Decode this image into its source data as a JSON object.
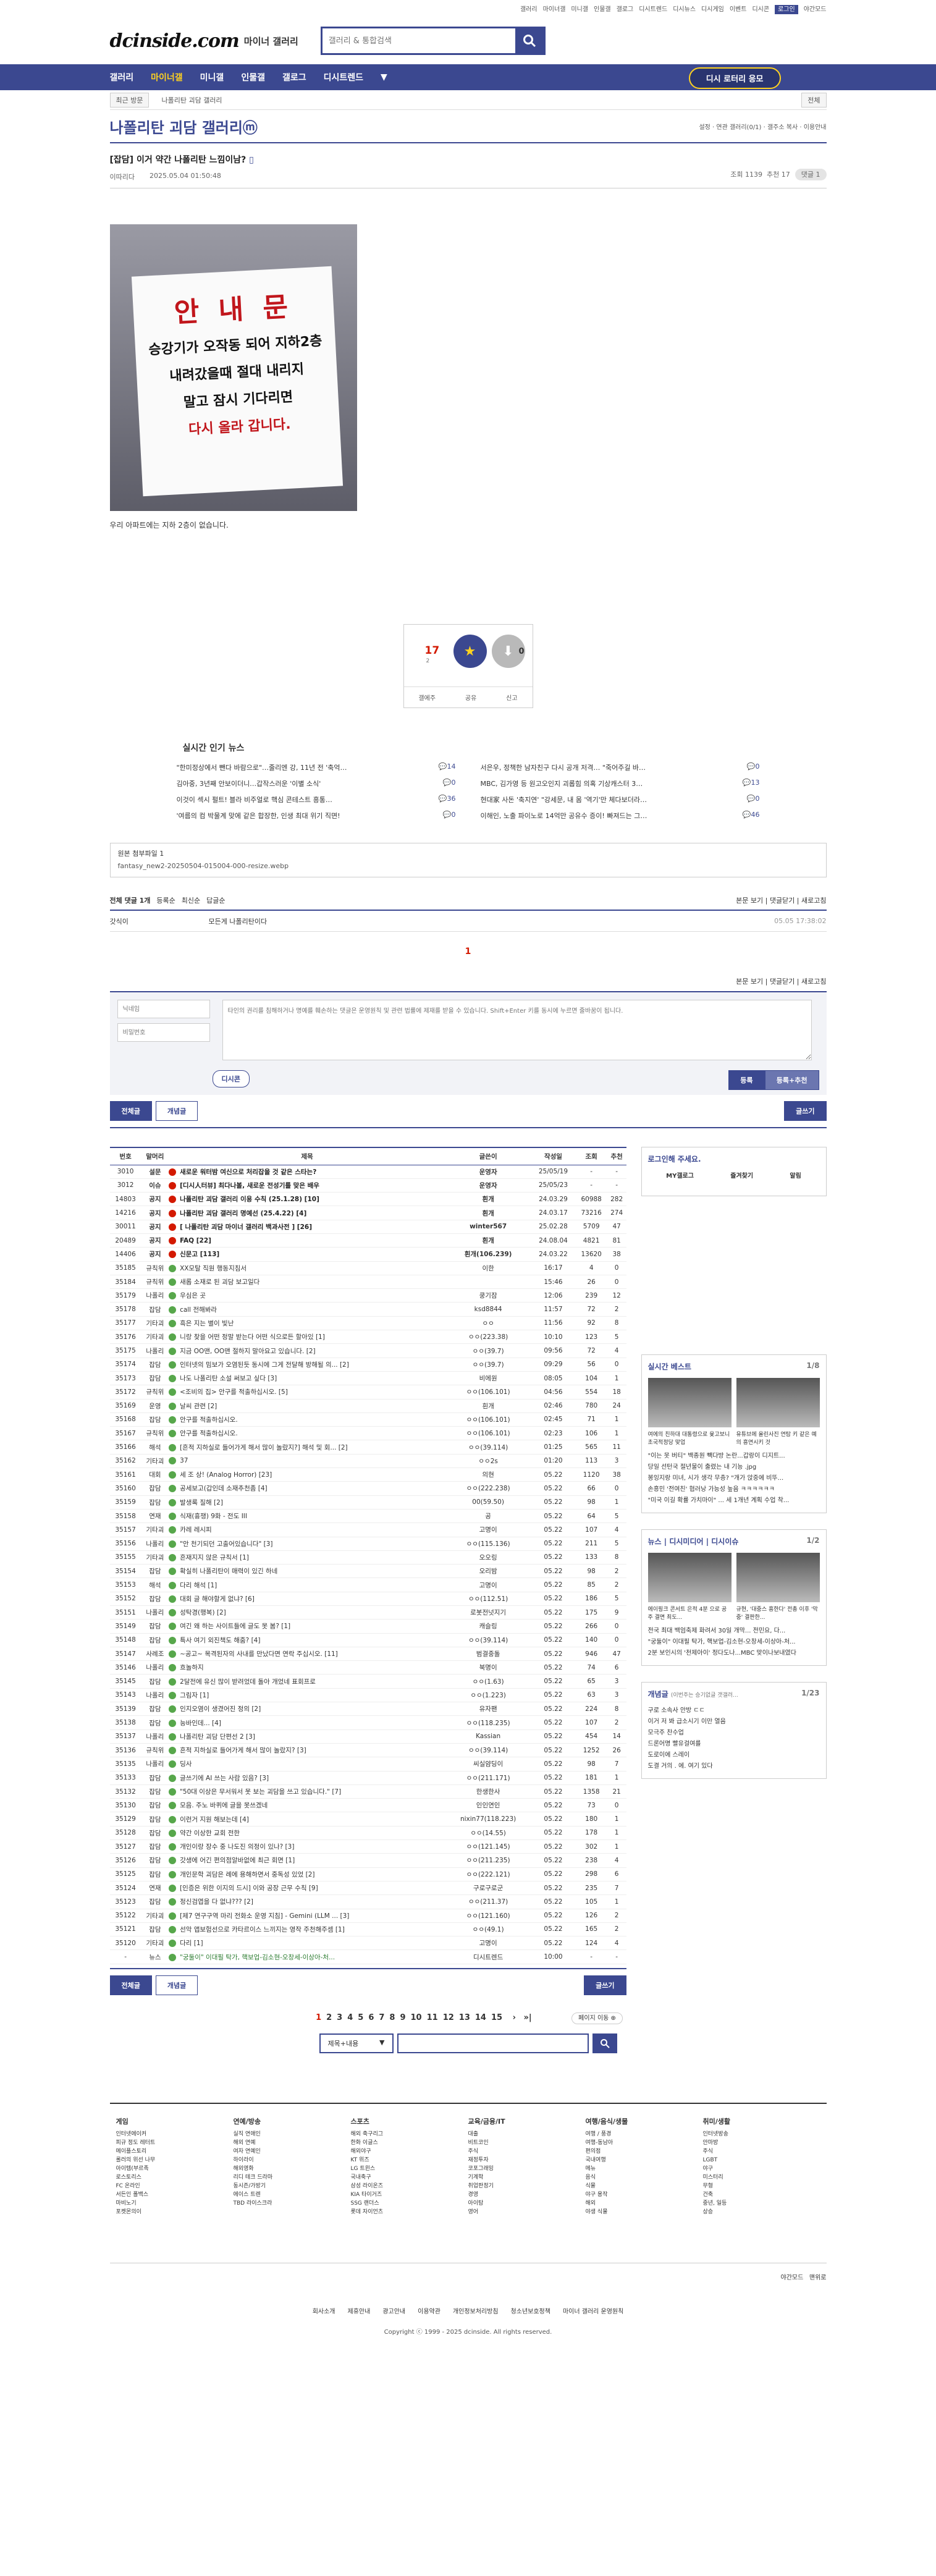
{
  "topbar": [
    "갤러리",
    "마이너갤",
    "미니갤",
    "인물갤",
    "갤로그",
    "디시트렌드",
    "디시뉴스",
    "디시게임",
    "이벤트",
    "디시콘",
    "로그인",
    "야간모드"
  ],
  "header": {
    "logo": "dcinside.com",
    "logo_sub": "마이너 갤러리",
    "search_placeholder": "갤러리 & 통합검색"
  },
  "nav": {
    "items": [
      "갤러리",
      "마이너갤",
      "미니갤",
      "인물갤",
      "갤로그",
      "디시트렌드"
    ],
    "menu_button": "디시 로터리 응모"
  },
  "subnav": {
    "recent": "최근 방문",
    "gallery": "나폴리탄 괴담 갤러리",
    "close": "전체"
  },
  "gallery": {
    "title": "나폴리탄 괴담 갤러리ⓜ",
    "options": "설정 · 연관 갤러리(0/1) · 갤주소 복사 · 이용안내"
  },
  "post": {
    "category": "[잡담]",
    "title": "이거 약간 나폴리탄 느낌이남?",
    "author": "이따리다",
    "date": "2025.05.04 01:50:48",
    "views": "조회 1139",
    "recommend": "추천 17",
    "comments": "댓글 1",
    "notice_big": "안 내 문",
    "notice_lines": [
      "승강기가 오작동 되어 지하2층",
      "내려갔을때 절대 내리지",
      "말고 잠시 기다리면",
      "다시 올라 갑니다."
    ],
    "body": "우리 아파트에는 지하 2층이 없습니다."
  },
  "recommend_box": {
    "up": "17",
    "up_sub": "2",
    "up_label": "개념",
    "down": "0",
    "share": "공유",
    "report": "신고",
    "gallery_share": "갤에주"
  },
  "news": {
    "title": "실시간 인기 뉴스",
    "items": [
      [
        "\"한미정상에서 뺀다 바람으로\"…줄리엔 강, 11년 전 '축억…",
        "14"
      ],
      [
        "서은우, 정책한 남자친구 다시 공개 저격… \"죽어주길 바…",
        "0"
      ],
      [
        "김아중, 3년째 안보이더니…갑작스러운 '이별 소식'",
        "0"
      ],
      [
        "MBC, 김가영 등 원고오인지 괴롭힘 의혹 기상캐스터 3…",
        "13"
      ],
      [
        "이것이 섹시 펄트! 블라 비주얼로 핵심 콘테스트 흥통…",
        "36"
      ],
      [
        "현대家 사돈 '축지연' \"강세문, 내 몸 '역기'만 체다보더라…",
        "0"
      ],
      [
        "'여름의 컴 박물계 맞에 같은 합장한, 인생 최대 위기 직면!",
        "0"
      ],
      [
        "이해인, 노출 파이노로 14억만 공유수 증이! 빠져드는 그…",
        "46"
      ]
    ]
  },
  "attach": {
    "label": "원본 첨부파일 1",
    "file": "fantasy_new2-20250504-015004-000-resize.webp"
  },
  "comment_head": {
    "all": "전체 댓글 1개",
    "opt1": "등록순",
    "opt2": "최신순",
    "opt3": "답글순",
    "right": "본문 보기 | 댓글닫기 | 새로고침"
  },
  "comment": {
    "author": "갓식이",
    "text": "모든게 나폴리탄이다",
    "date": "05.05 17:38:02"
  },
  "comment_page": "1",
  "write": {
    "name": "닉네임",
    "pw": "비밀번호",
    "content": "타인의 권리를 침해하거나 명예를 훼손하는 댓글은 운영원칙 및 관련 법률에 제재를 받을 수 있습니다. Shift+Enter 키를 동시에 누르면 줄바꿈이 됩니다.",
    "dccon": "디시콘",
    "submit": "등록",
    "submit2": "등록+추천"
  },
  "listbar": {
    "all": "전체글",
    "best": "개념글",
    "write": "글쓰기"
  },
  "table": {
    "headers": [
      "번호",
      "말머리",
      "제목",
      "글쓴이",
      "작성일",
      "조회",
      "추천"
    ],
    "rows": [
      [
        "3010",
        "설문",
        "새로운 워터밤 여신으로 처리잡을 것 같은 스타는?",
        "운영자",
        "25/05/19",
        "-",
        "-",
        "nt"
      ],
      [
        "3012",
        "이슈",
        "[디시人터뷰] 최다나볼, 새로운 전성기를 맞은 배우",
        "운영자",
        "25/05/23",
        "-",
        "-",
        "nt"
      ],
      [
        "14803",
        "공지",
        "나폴리탄 괴담 갤러리 이용 수칙 (25.1.28) [10]",
        "흰개",
        "24.03.29",
        "60988",
        "282",
        "nt"
      ],
      [
        "14216",
        "공지",
        "나폴리탄 괴담 갤러리 명예선 (25.4.22) [4]",
        "흰개",
        "24.03.17",
        "73216",
        "274",
        "nt"
      ],
      [
        "30011",
        "공지",
        "[ 나폴리탄 괴담 마이너 갤러리 백과사전 ] [26]",
        "winter567",
        "25.02.28",
        "5709",
        "47",
        "nt"
      ],
      [
        "20489",
        "공지",
        "FAQ [22]",
        "흰개",
        "24.08.04",
        "4821",
        "81",
        "nt"
      ],
      [
        "14406",
        "공지",
        "신문고 [113]",
        "흰개(106.239)",
        "24.03.22",
        "13620",
        "38",
        "nt"
      ],
      [
        "35185",
        "규칙위",
        "XX모탈 직원 행동지침서",
        "이한",
        "16:17",
        "4",
        "0",
        ""
      ],
      [
        "35184",
        "규칙위",
        "새롭 소재로 된 괴담 보고일다",
        "",
        "15:46",
        "26",
        "0",
        ""
      ],
      [
        "35179",
        "나폴리",
        "우심은 곳",
        "쿵기잠",
        "12:06",
        "239",
        "12",
        ""
      ],
      [
        "35178",
        "잡담",
        "call 전해봐라",
        "ksd8844",
        "11:57",
        "72",
        "2",
        ""
      ],
      [
        "35177",
        "기타괴",
        "흑은 지는 별이 빛난",
        "ㅇㅇ",
        "11:56",
        "92",
        "8",
        ""
      ],
      [
        "35176",
        "기타괴",
        "니랑 찾을 어떤 정말 받는다 어떤 식으로든 할아있 [1]",
        "ㅇㅇ(223.38)",
        "10:10",
        "123",
        "5",
        ""
      ],
      [
        "35175",
        "나폴리",
        "지금 OO맨, OO맨 절하지 말아요고 있습니다. [2]",
        "ㅇㅇ(39.7)",
        "09:56",
        "72",
        "4",
        ""
      ],
      [
        "35174",
        "잡담",
        "인터넷의 밈보가 오염된듯 동시에 그게 전달해 방해될 의... [2]",
        "ㅇㅇ(39.7)",
        "09:29",
        "56",
        "0",
        ""
      ],
      [
        "35173",
        "잡담",
        "나도 나폴리탄 소설 써보고 싶다 [3]",
        "비에원",
        "08:05",
        "104",
        "1",
        ""
      ],
      [
        "35172",
        "규칙위",
        "<조비의 집> 안구를 적출하십시오. [5]",
        "ㅇㅇ(106.101)",
        "04:56",
        "554",
        "18",
        ""
      ],
      [
        "35169",
        "운영",
        "날씨 관련 [2]",
        "흰개",
        "02:46",
        "780",
        "24",
        ""
      ],
      [
        "35168",
        "잡담",
        "안구를 적출하십시오.",
        "ㅇㅇ(106.101)",
        "02:45",
        "71",
        "1",
        ""
      ],
      [
        "35167",
        "규칙위",
        "안구를 적출하십시오.",
        "ㅇㅇ(106.101)",
        "02:23",
        "106",
        "1",
        ""
      ],
      [
        "35166",
        "해석",
        "[흔적 지하실로 들어가게 해서 많이 놀랐지?] 해석 및 회... [2]",
        "ㅇㅇ(39.114)",
        "01:25",
        "565",
        "11",
        ""
      ],
      [
        "35162",
        "기타괴",
        "37",
        "ㅇㅇ2s",
        "01:20",
        "113",
        "3",
        ""
      ],
      [
        "35161",
        "대회",
        "세 조 상! (Analog Horror) [23]",
        "의현",
        "05.22",
        "1120",
        "38",
        ""
      ],
      [
        "35160",
        "잡담",
        "공세보고(갑인데 소재추천좀 [4]",
        "ㅇㅇ(222.238)",
        "05.22",
        "66",
        "0",
        ""
      ],
      [
        "35159",
        "잡담",
        "발생록 질해 [2]",
        "00(59.50)",
        "05.22",
        "98",
        "1",
        ""
      ],
      [
        "35158",
        "연재",
        "식재(흉쟁) 9화 - 전도 III",
        "공",
        "05.22",
        "64",
        "5",
        ""
      ],
      [
        "35157",
        "기타괴",
        "카레 레시피",
        "고명이",
        "05.22",
        "107",
        "4",
        ""
      ],
      [
        "35156",
        "나폴리",
        "\"안 천기되던 고출어있습니다\" [3]",
        "ㅇㅇ(115.136)",
        "05.22",
        "211",
        "5",
        ""
      ],
      [
        "35155",
        "기타괴",
        "흔재지지 않은 규칙서 [1]",
        "오오링",
        "05.22",
        "133",
        "8",
        ""
      ],
      [
        "35154",
        "잡담",
        "확실히 나폴리탄이 매력이 있긴 하네",
        "오리밤",
        "05.22",
        "98",
        "2",
        ""
      ],
      [
        "35153",
        "해석",
        "다리 해석 [1]",
        "고명이",
        "05.22",
        "85",
        "2",
        ""
      ],
      [
        "35152",
        "잡담",
        "대회 글 해야할게 없냐? [6]",
        "ㅇㅇ(112.51)",
        "05.22",
        "186",
        "5",
        ""
      ],
      [
        "35151",
        "나폴리",
        "성탁경(행복) [2]",
        "로봇전넛지기",
        "05.22",
        "175",
        "9",
        ""
      ],
      [
        "35149",
        "잡담",
        "여긴 왜 하는 사이트들에 글도 못 봄? [1]",
        "캐슬링",
        "05.22",
        "266",
        "0",
        ""
      ],
      [
        "35148",
        "잡담",
        "특사 여기 외진책도 해줌? [4]",
        "ㅇㅇ(39.114)",
        "05.22",
        "140",
        "0",
        ""
      ],
      [
        "35147",
        "사례조",
        "~공고~ 목격된자의 사내를 만났다면 연락 주십시오. [11]",
        "범결중돌",
        "05.22",
        "946",
        "47",
        ""
      ],
      [
        "35146",
        "나폴리",
        "흐놀하지",
        "북명이",
        "05.22",
        "74",
        "6",
        ""
      ],
      [
        "35145",
        "잡담",
        "2달전에 유신 많이 받려었데 돌아 개었네 표회프로",
        "ㅇㅇ(1.63)",
        "05.22",
        "65",
        "3",
        ""
      ],
      [
        "35143",
        "나폴리",
        "그림자 [1]",
        "ㅇㅇ(1.223)",
        "05.22",
        "63",
        "3",
        ""
      ],
      [
        "35139",
        "잡담",
        "인지오염이 생겼어진 정의 [2]",
        "유자팬",
        "05.22",
        "224",
        "8",
        ""
      ],
      [
        "35138",
        "잡담",
        "능바인데... [4]",
        "ㅇㅇ(118.235)",
        "05.22",
        "107",
        "2",
        ""
      ],
      [
        "35137",
        "나폴리",
        "나폴리탄 괴담 단편선 2 [3]",
        "Kassian",
        "05.22",
        "454",
        "14",
        ""
      ],
      [
        "35136",
        "규칙위",
        "흔적 지하실로 들어가게 해서 많이 놀랐지? [3]",
        "ㅇㅇ(39.114)",
        "05.22",
        "1252",
        "26",
        ""
      ],
      [
        "35135",
        "나폴리",
        "딩사",
        "씨실얌딩이",
        "05.22",
        "98",
        "7",
        ""
      ],
      [
        "35133",
        "잡담",
        "글쓰기에 AI 쓰는 사람 있음? [3]",
        "ㅇㅇ(211.171)",
        "05.22",
        "181",
        "1",
        ""
      ],
      [
        "35132",
        "잡담",
        "\"50대 이상은 무서워서 못 보는 괴담을 쓰고 있습니다.\" [7]",
        "한생한사",
        "05.22",
        "1358",
        "21",
        ""
      ],
      [
        "35130",
        "잡담",
        "모음. 주노 바퀴에 글을 못쓰겠네",
        "인인연인",
        "05.22",
        "73",
        "0",
        ""
      ],
      [
        "35129",
        "잡담",
        "이런거 지원 해보는데 [4]",
        "nixin77(118.223)",
        "05.22",
        "180",
        "1",
        ""
      ],
      [
        "35128",
        "잡담",
        "약간 이상한 교회 전한",
        "ㅇㅇ(14.55)",
        "05.22",
        "178",
        "1",
        ""
      ],
      [
        "35127",
        "잡담",
        "개인이랑 장수 중 나도진 의정이 있나? [3]",
        "ㅇㅇ(121.145)",
        "05.22",
        "302",
        "1",
        ""
      ],
      [
        "35126",
        "잡담",
        "갓생에 어긴 편의점알바없에 최근 회면 [1]",
        "ㅇㅇ(211.235)",
        "05.22",
        "238",
        "4",
        ""
      ],
      [
        "35125",
        "잡담",
        "개인문학 괴담은 례에 용해하면서 중독성 있었 [2]",
        "ㅇㅇ(222.121)",
        "05.22",
        "298",
        "6",
        ""
      ],
      [
        "35124",
        "연재",
        "[인증은 위한 이지의 드시] 이와 공장 근무 수칙 [9]",
        "구로구로군",
        "05.22",
        "235",
        "7",
        ""
      ],
      [
        "35123",
        "잡담",
        "정신검엽을 다 없냐??? [2]",
        "ㅇㅇ(211.37)",
        "05.22",
        "105",
        "1",
        ""
      ],
      [
        "35122",
        "기타괴",
        "[제7 연구구역 마리 전화소 운영 지침] - Gemini (LLM ... [3]",
        "ㅇㅇ(121.160)",
        "05.22",
        "126",
        "2",
        ""
      ],
      [
        "35121",
        "잡담",
        "선악 앱보험선으로 카타르이스 느끼지는 영작 주천해주셈 [1]",
        "ㅇㅇ(49.1)",
        "05.22",
        "165",
        "2",
        ""
      ],
      [
        "35120",
        "기타괴",
        "다리 [1]",
        "고명이",
        "05.22",
        "124",
        "4",
        ""
      ],
      [
        "-",
        "뉴스",
        "\"궁둘이\" 이대필 탁가, 핵보업-김소현-오창세-이상아-처...",
        "디시트렌드",
        "10:00",
        "-",
        "-",
        "news"
      ]
    ]
  },
  "login_box": {
    "title": "로그인해 주세요.",
    "b1": "MY갤로그",
    "b2": "즐겨찾기",
    "b3": "알림"
  },
  "side_best": {
    "title": "실시간 베스트",
    "page": "1/8",
    "cap1": "여에의 친하대 대통령으로 윷고보니 초국적정당 맞업",
    "cap2": "유튜브에 올린사진 연탐 키 같은 예의 흥연시키 것",
    "list": [
      "\"이는 못 버티\" 백종원 빽다방 논란...갑랑이 디지트...",
      "당일 선턴국 절년물이 출렸는 내 기능 .jpg",
      "봉잉지랑 미녀, 시가 생각 무층? \"개가 앉중에 비뚜...",
      "손흥민 '전여친' 협러낭 가능성 높음 ㅋㅋㅋㅋㅋㅋ",
      "\"미국 이길 확률 가치마이\" ... 세 1개년 계획 수업 착..."
    ]
  },
  "side_news": {
    "tabs": "뉴스 | 디시미디어 | 디시이슈",
    "page": "1/2",
    "cap1": "에이핑크 콘서트 은적 4분 으로 공주 결면 최도...",
    "cap2": "규현, '대중스 흥한다' 전총 이후 '막중' 결판한...",
    "list": [
      "전국 최대 백엄축제 화려서 30일 개막... 전민요, 다...",
      "\"궁둘이\" 이대필 탁가, 핵보업-김소현-오창세-이상아-처...",
      "2분 보인시의 '천제아이' 정다도나...MBC 맞이나보내였다"
    ]
  },
  "side_gall": {
    "title": "개념글",
    "subtitle": "(이번주는 승기없글 갯갤러...",
    "page": "1/23",
    "list": [
      "구로 소속사 안방 ㄷㄷ",
      "이거 저 봐 급소시기 이만 열음",
      "모극주 찬수업",
      "드론어명 빨유걸여를",
      "도로이에 스레이",
      "도결 거의 . 에. 여기 있다"
    ]
  },
  "pages": {
    "nums": [
      "1",
      "2",
      "3",
      "4",
      "5",
      "6",
      "7",
      "8",
      "9",
      "10",
      "11",
      "12",
      "13",
      "14",
      "15"
    ],
    "next": "›",
    "last": "»|",
    "search_next": "페이지 이동 ⊕"
  },
  "search2": {
    "select": "제목+내용"
  },
  "footer": {
    "cols": [
      {
        "h": "게임",
        "l": [
          "인터넷에이커",
          "피규 정도 레터트",
          "메이플스토리",
          "롤러의 위선 나무",
          "아이템(부르족",
          "로스토리스",
          "FC 온라인",
          "서든인 폴백스",
          "마비노기",
          "포켓몬의이"
        ]
      },
      {
        "h": "연예/방송",
        "l": [
          "실직 연애인",
          "해외 연예",
          "여자 연예인",
          "하이라이",
          "해외영화",
          "리디 테크 드라마",
          "동시즌/가방기",
          "에이스 트렌",
          "TBD 라이스크라"
        ]
      },
      {
        "h": "스포츠",
        "l": [
          "해외 축구리그",
          "한화 이글스",
          "해외야구",
          "KT 위즈",
          "LG 트윈스",
          "국내축구",
          "삼성 라이온즈",
          "KIA 타이거즈",
          "SSG 랜더스",
          "롯데 자이언츠"
        ]
      },
      {
        "h": "교육/금융/IT",
        "l": [
          "대출",
          "비트코인",
          "주식",
          "재정투자",
          "코포그래밍",
          "기계학",
          "취업판정기",
          "경영",
          "아이탐",
          "영어"
        ]
      },
      {
        "h": "여행/음식/생물",
        "l": [
          "여행 / 풍경",
          "여행-동남아",
          "편의점",
          "국내여행",
          "메뉴",
          "음식",
          "식물",
          "야구 용작",
          "해외",
          "야생 식물"
        ]
      },
      {
        "h": "취미/생활",
        "l": [
          "인터넷방송",
          "안마방",
          "주식",
          "LGBT",
          "야구",
          "미스터리",
          "무형",
          "건축",
          "중년, 일등",
          "상승"
        ]
      }
    ]
  },
  "bottom": {
    "night": "야간모드",
    "top": "맨위로",
    "links": [
      "회사소개",
      "제휴안내",
      "광고안내",
      "이용약관",
      "개인정보처리방침",
      "청소년보호정책",
      "마이너 갤러리 운영원칙"
    ],
    "copyright": "Copyright ⓒ 1999 - 2025 dcinside. All rights reserved."
  }
}
